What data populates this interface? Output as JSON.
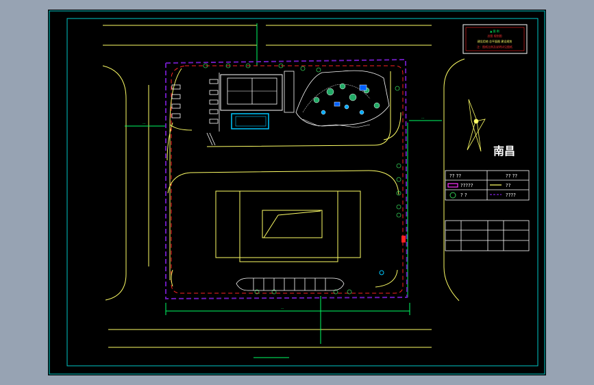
{
  "city_label": "南昌",
  "title_block": {
    "line1": "▲ 图 例",
    "line2": "总图 规划图",
    "line3": "建设用地 总平面图 建设规划",
    "line4": "注：图纸比例及说明详见图纸"
  },
  "legend": {
    "header_left": "?? ??",
    "header_right": "?? ??",
    "row2_left": "?????",
    "row2_right": "??",
    "row3_left": "?  ?",
    "row3_right": "????"
  },
  "road_labels": {
    "top_left_dim": "---",
    "right_dim": "---",
    "bottom_dim": "---"
  },
  "colors": {
    "background": "#000000",
    "frame": "#00c8c8",
    "road": "#ffff66",
    "boundary": "#6a1ab8",
    "redline": "#ff2222",
    "dim": "#00ff66",
    "legend": "#ffffff"
  }
}
